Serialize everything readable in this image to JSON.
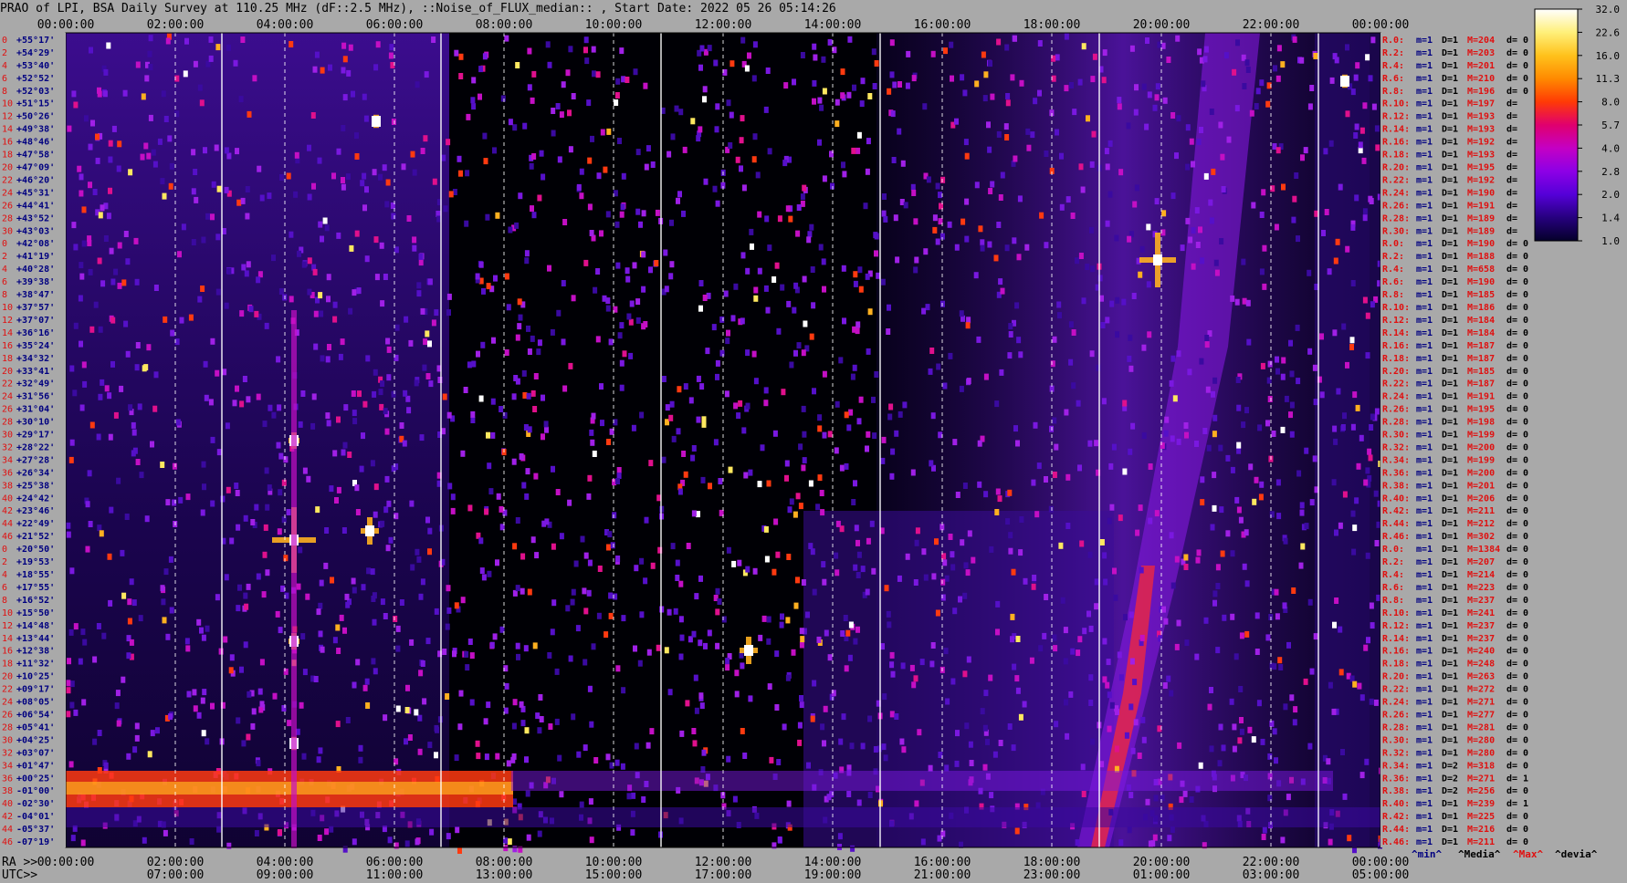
{
  "title": "PRAO of LPI, BSA Daily Survey at 110.25 MHz (dF::2.5 MHz), ::Noise_of_FLUX_median:: , Start Date: 2022 05 26 05:14:26",
  "chart_data": {
    "type": "heatmap",
    "title": "PRAO of LPI, BSA Daily Survey at 110.25 MHz (dF::2.5 MHz), ::Noise_of_FLUX_median:: , Start Date: 2022 05 26 05:14:26",
    "top_axis_ticks": [
      "00:00:00",
      "02:00:00",
      "04:00:00",
      "06:00:00",
      "08:00:00",
      "10:00:00",
      "12:00:00",
      "14:00:00",
      "16:00:00",
      "18:00:00",
      "20:00:00",
      "22:00:00",
      "00:00:00"
    ],
    "ra_axis_label": "RA >>",
    "ra_axis_ticks": [
      "00:00:00",
      "02:00:00",
      "04:00:00",
      "06:00:00",
      "08:00:00",
      "10:00:00",
      "12:00:00",
      "14:00:00",
      "16:00:00",
      "18:00:00",
      "20:00:00",
      "22:00:00",
      "00:00:00"
    ],
    "utc_axis_label": "UTC>>",
    "utc_axis_ticks": [
      "07:00:00",
      "09:00:00",
      "11:00:00",
      "13:00:00",
      "15:00:00",
      "17:00:00",
      "19:00:00",
      "21:00:00",
      "23:00:00",
      "01:00:00",
      "03:00:00",
      "05:00:00"
    ],
    "dec_labels": [
      "+55°17'",
      "+54°29'",
      "+53°40'",
      "+52°52'",
      "+52°03'",
      "+51°15'",
      "+50°26'",
      "+49°38'",
      "+48°46'",
      "+47°58'",
      "+47°09'",
      "+46°20'",
      "+45°31'",
      "+44°41'",
      "+43°52'",
      "+43°03'",
      "+42°08'",
      "+41°19'",
      "+40°28'",
      "+39°38'",
      "+38°47'",
      "+37°57'",
      "+37°07'",
      "+36°16'",
      "+35°24'",
      "+34°32'",
      "+33°41'",
      "+32°49'",
      "+31°56'",
      "+31°04'",
      "+30°10'",
      "+29°17'",
      "+28°22'",
      "+27°28'",
      "+26°34'",
      "+25°38'",
      "+24°42'",
      "+23°46'",
      "+22°49'",
      "+21°52'",
      "+20°50'",
      "+19°53'",
      "+18°55'",
      "+17°55'",
      "+16°52'",
      "+15°50'",
      "+14°48'",
      "+13°44'",
      "+12°38'",
      "+11°32'",
      "+10°25'",
      "+09°17'",
      "+08°05'",
      "+06°54'",
      "+05°41'",
      "+04°25'",
      "+03°07'",
      "+01°47'",
      "+00°25'",
      "-01°00'",
      "-02°30'",
      "-04°01'",
      "-05°37'",
      "-07°19'"
    ],
    "row_index_labels": [
      "0",
      "2",
      "4",
      "6",
      "8",
      "10",
      "12",
      "14",
      "16",
      "18",
      "20",
      "22",
      "24",
      "26",
      "28",
      "30",
      "0",
      "2",
      "4",
      "6",
      "8",
      "10",
      "12",
      "14",
      "16",
      "18",
      "20",
      "22",
      "24",
      "26",
      "28",
      "30",
      "32",
      "34",
      "36",
      "38",
      "40",
      "42",
      "44",
      "46",
      "0",
      "2",
      "4",
      "6",
      "8",
      "10",
      "12",
      "14",
      "16",
      "18",
      "20",
      "22",
      "24",
      "26",
      "28",
      "30",
      "32",
      "34",
      "36",
      "38",
      "40",
      "42",
      "44",
      "46"
    ],
    "stats": [
      {
        "r": "R.0:",
        "m": "m=1",
        "d": "D=1",
        "M": "M=204",
        "dv": "d= 0"
      },
      {
        "r": "R.2:",
        "m": "m=1",
        "d": "D=1",
        "M": "M=203",
        "dv": "d= 0"
      },
      {
        "r": "R.4:",
        "m": "m=1",
        "d": "D=1",
        "M": "M=201",
        "dv": "d= 0"
      },
      {
        "r": "R.6:",
        "m": "m=1",
        "d": "D=1",
        "M": "M=210",
        "dv": "d= 0"
      },
      {
        "r": "R.8:",
        "m": "m=1",
        "d": "D=1",
        "M": "M=196",
        "dv": "d= 0"
      },
      {
        "r": "R.10:",
        "m": "m=1",
        "d": "D=1",
        "M": "M=197",
        "dv": "d="
      },
      {
        "r": "R.12:",
        "m": "m=1",
        "d": "D=1",
        "M": "M=193",
        "dv": "d="
      },
      {
        "r": "R.14:",
        "m": "m=1",
        "d": "D=1",
        "M": "M=193",
        "dv": "d="
      },
      {
        "r": "R.16:",
        "m": "m=1",
        "d": "D=1",
        "M": "M=192",
        "dv": "d="
      },
      {
        "r": "R.18:",
        "m": "m=1",
        "d": "D=1",
        "M": "M=193",
        "dv": "d="
      },
      {
        "r": "R.20:",
        "m": "m=1",
        "d": "D=1",
        "M": "M=195",
        "dv": "d="
      },
      {
        "r": "R.22:",
        "m": "m=1",
        "d": "D=1",
        "M": "M=192",
        "dv": "d="
      },
      {
        "r": "R.24:",
        "m": "m=1",
        "d": "D=1",
        "M": "M=190",
        "dv": "d="
      },
      {
        "r": "R.26:",
        "m": "m=1",
        "d": "D=1",
        "M": "M=191",
        "dv": "d="
      },
      {
        "r": "R.28:",
        "m": "m=1",
        "d": "D=1",
        "M": "M=189",
        "dv": "d="
      },
      {
        "r": "R.30:",
        "m": "m=1",
        "d": "D=1",
        "M": "M=189",
        "dv": "d="
      },
      {
        "r": "R.0:",
        "m": "m=1",
        "d": "D=1",
        "M": "M=190",
        "dv": "d= 0"
      },
      {
        "r": "R.2:",
        "m": "m=1",
        "d": "D=1",
        "M": "M=188",
        "dv": "d= 0"
      },
      {
        "r": "R.4:",
        "m": "m=1",
        "d": "D=1",
        "M": "M=658",
        "dv": "d= 0"
      },
      {
        "r": "R.6:",
        "m": "m=1",
        "d": "D=1",
        "M": "M=190",
        "dv": "d= 0"
      },
      {
        "r": "R.8:",
        "m": "m=1",
        "d": "D=1",
        "M": "M=185",
        "dv": "d= 0"
      },
      {
        "r": "R.10:",
        "m": "m=1",
        "d": "D=1",
        "M": "M=186",
        "dv": "d= 0"
      },
      {
        "r": "R.12:",
        "m": "m=1",
        "d": "D=1",
        "M": "M=184",
        "dv": "d= 0"
      },
      {
        "r": "R.14:",
        "m": "m=1",
        "d": "D=1",
        "M": "M=184",
        "dv": "d= 0"
      },
      {
        "r": "R.16:",
        "m": "m=1",
        "d": "D=1",
        "M": "M=187",
        "dv": "d= 0"
      },
      {
        "r": "R.18:",
        "m": "m=1",
        "d": "D=1",
        "M": "M=187",
        "dv": "d= 0"
      },
      {
        "r": "R.20:",
        "m": "m=1",
        "d": "D=1",
        "M": "M=185",
        "dv": "d= 0"
      },
      {
        "r": "R.22:",
        "m": "m=1",
        "d": "D=1",
        "M": "M=187",
        "dv": "d= 0"
      },
      {
        "r": "R.24:",
        "m": "m=1",
        "d": "D=1",
        "M": "M=191",
        "dv": "d= 0"
      },
      {
        "r": "R.26:",
        "m": "m=1",
        "d": "D=1",
        "M": "M=195",
        "dv": "d= 0"
      },
      {
        "r": "R.28:",
        "m": "m=1",
        "d": "D=1",
        "M": "M=198",
        "dv": "d= 0"
      },
      {
        "r": "R.30:",
        "m": "m=1",
        "d": "D=1",
        "M": "M=199",
        "dv": "d= 0"
      },
      {
        "r": "R.32:",
        "m": "m=1",
        "d": "D=1",
        "M": "M=200",
        "dv": "d= 0"
      },
      {
        "r": "R.34:",
        "m": "m=1",
        "d": "D=1",
        "M": "M=199",
        "dv": "d= 0"
      },
      {
        "r": "R.36:",
        "m": "m=1",
        "d": "D=1",
        "M": "M=200",
        "dv": "d= 0"
      },
      {
        "r": "R.38:",
        "m": "m=1",
        "d": "D=1",
        "M": "M=201",
        "dv": "d= 0"
      },
      {
        "r": "R.40:",
        "m": "m=1",
        "d": "D=1",
        "M": "M=206",
        "dv": "d= 0"
      },
      {
        "r": "R.42:",
        "m": "m=1",
        "d": "D=1",
        "M": "M=211",
        "dv": "d= 0"
      },
      {
        "r": "R.44:",
        "m": "m=1",
        "d": "D=1",
        "M": "M=212",
        "dv": "d= 0"
      },
      {
        "r": "R.46:",
        "m": "m=1",
        "d": "D=1",
        "M": "M=302",
        "dv": "d= 0"
      },
      {
        "r": "R.0:",
        "m": "m=1",
        "d": "D=1",
        "M": "M=1384",
        "dv": "d= 0"
      },
      {
        "r": "R.2:",
        "m": "m=1",
        "d": "D=1",
        "M": "M=207",
        "dv": "d= 0"
      },
      {
        "r": "R.4:",
        "m": "m=1",
        "d": "D=1",
        "M": "M=214",
        "dv": "d= 0"
      },
      {
        "r": "R.6:",
        "m": "m=1",
        "d": "D=1",
        "M": "M=223",
        "dv": "d= 0"
      },
      {
        "r": "R.8:",
        "m": "m=1",
        "d": "D=1",
        "M": "M=237",
        "dv": "d= 0"
      },
      {
        "r": "R.10:",
        "m": "m=1",
        "d": "D=1",
        "M": "M=241",
        "dv": "d= 0"
      },
      {
        "r": "R.12:",
        "m": "m=1",
        "d": "D=1",
        "M": "M=237",
        "dv": "d= 0"
      },
      {
        "r": "R.14:",
        "m": "m=1",
        "d": "D=1",
        "M": "M=237",
        "dv": "d= 0"
      },
      {
        "r": "R.16:",
        "m": "m=1",
        "d": "D=1",
        "M": "M=240",
        "dv": "d= 0"
      },
      {
        "r": "R.18:",
        "m": "m=1",
        "d": "D=1",
        "M": "M=248",
        "dv": "d= 0"
      },
      {
        "r": "R.20:",
        "m": "m=1",
        "d": "D=1",
        "M": "M=263",
        "dv": "d= 0"
      },
      {
        "r": "R.22:",
        "m": "m=1",
        "d": "D=1",
        "M": "M=272",
        "dv": "d= 0"
      },
      {
        "r": "R.24:",
        "m": "m=1",
        "d": "D=1",
        "M": "M=271",
        "dv": "d= 0"
      },
      {
        "r": "R.26:",
        "m": "m=1",
        "d": "D=1",
        "M": "M=277",
        "dv": "d= 0"
      },
      {
        "r": "R.28:",
        "m": "m=1",
        "d": "D=1",
        "M": "M=281",
        "dv": "d= 0"
      },
      {
        "r": "R.30:",
        "m": "m=1",
        "d": "D=1",
        "M": "M=280",
        "dv": "d= 0"
      },
      {
        "r": "R.32:",
        "m": "m=1",
        "d": "D=1",
        "M": "M=280",
        "dv": "d= 0"
      },
      {
        "r": "R.34:",
        "m": "m=1",
        "d": "D=2",
        "M": "M=318",
        "dv": "d= 0"
      },
      {
        "r": "R.36:",
        "m": "m=1",
        "d": "D=2",
        "M": "M=271",
        "dv": "d= 1"
      },
      {
        "r": "R.38:",
        "m": "m=1",
        "d": "D=2",
        "M": "M=256",
        "dv": "d= 0"
      },
      {
        "r": "R.40:",
        "m": "m=1",
        "d": "D=1",
        "M": "M=239",
        "dv": "d= 1"
      },
      {
        "r": "R.42:",
        "m": "m=1",
        "d": "D=1",
        "M": "M=225",
        "dv": "d= 0"
      },
      {
        "r": "R.44:",
        "m": "m=1",
        "d": "D=1",
        "M": "M=216",
        "dv": "d= 0"
      },
      {
        "r": "R.46:",
        "m": "m=1",
        "d": "D=1",
        "M": "M=211",
        "dv": "d= 0"
      }
    ],
    "stats_legend": [
      "^min^",
      "^Media^",
      "^Max^",
      "^devia^"
    ],
    "colorbar": {
      "ticks": [
        "32.0",
        "22.6",
        "16.0",
        "11.3",
        "8.0",
        "5.7",
        "4.0",
        "2.8",
        "2.0",
        "1.4",
        "1.0"
      ],
      "colors": [
        "#ffffff",
        "#fff07a",
        "#ffc21c",
        "#ff8a00",
        "#ff3a05",
        "#e0006e",
        "#c400c4",
        "#8d00e6",
        "#5500d8",
        "#26007e",
        "#05002a"
      ]
    },
    "palette": {
      "background": "#000005",
      "sky": "#2a0a6e",
      "hot": "#ff3b00",
      "white": "#ffffff",
      "stat_red": "#e01010",
      "stat_blue": "#000080"
    }
  }
}
